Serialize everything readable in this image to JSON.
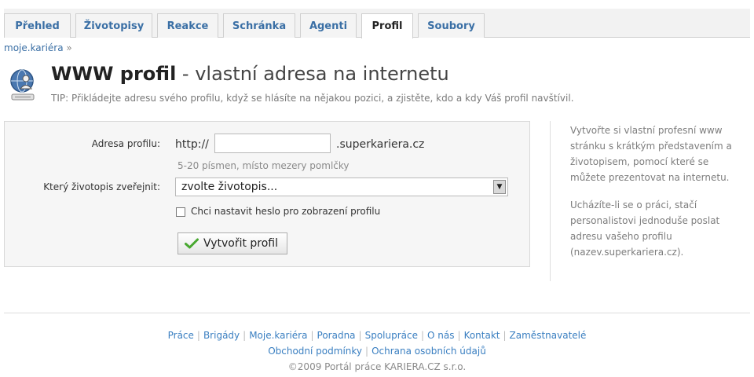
{
  "tabs": [
    {
      "label": "Přehled"
    },
    {
      "label": "Životopisy"
    },
    {
      "label": "Reakce"
    },
    {
      "label": "Schránka"
    },
    {
      "label": "Agenti"
    },
    {
      "label": "Profil",
      "active": true
    },
    {
      "label": "Soubory"
    }
  ],
  "breadcrumb": {
    "link": "moje.kariéra",
    "sep": "»"
  },
  "header": {
    "title_bold": "WWW profil",
    "title_rest": " - vlastní adresa na internetu",
    "tip": "TIP: Přikládejte adresu svého profilu, když se hlásíte na nějakou pozici, a zjistěte, kdo a kdy Váš profil navštívil.",
    "icon": "globe-user-icon"
  },
  "form": {
    "address_label": "Adresa profilu:",
    "protocol": "http://",
    "address_value": "",
    "domain_suffix": ".superkariera.cz",
    "address_hint": "5-20 písmen, místo mezery pomlčky",
    "cv_label": "Který životopis zveřejnit:",
    "cv_selected": "zvolte životopis...",
    "password_checkbox_label": "Chci nastavit heslo pro zobrazení profilu",
    "password_checked": false,
    "submit_label": "Vytvořit profil",
    "submit_icon": "checkmark-icon"
  },
  "sidebar": {
    "para1": "Vytvořte si vlastní profesní www stránku s krátkým představením a životopisem, pomocí které se můžete prezentovat na internetu.",
    "para2": "Ucházíte-li se o práci, stačí personalistovi jednoduše poslat adresu vašeho profilu (nazev.superkariera.cz)."
  },
  "footer": {
    "links_row1": [
      "Práce",
      "Brigády",
      "Moje.kariéra",
      "Poradna",
      "Spolupráce",
      "O nás",
      "Kontakt",
      "Zaměstnavatelé"
    ],
    "links_row2": [
      "Obchodní podmínky",
      "Ochrana osobních údajů"
    ],
    "copyright": "©2009 Portál práce KARIERA.CZ s.r.o."
  },
  "colors": {
    "link": "#3a7fc1",
    "tab_text": "#3a6fa5"
  }
}
